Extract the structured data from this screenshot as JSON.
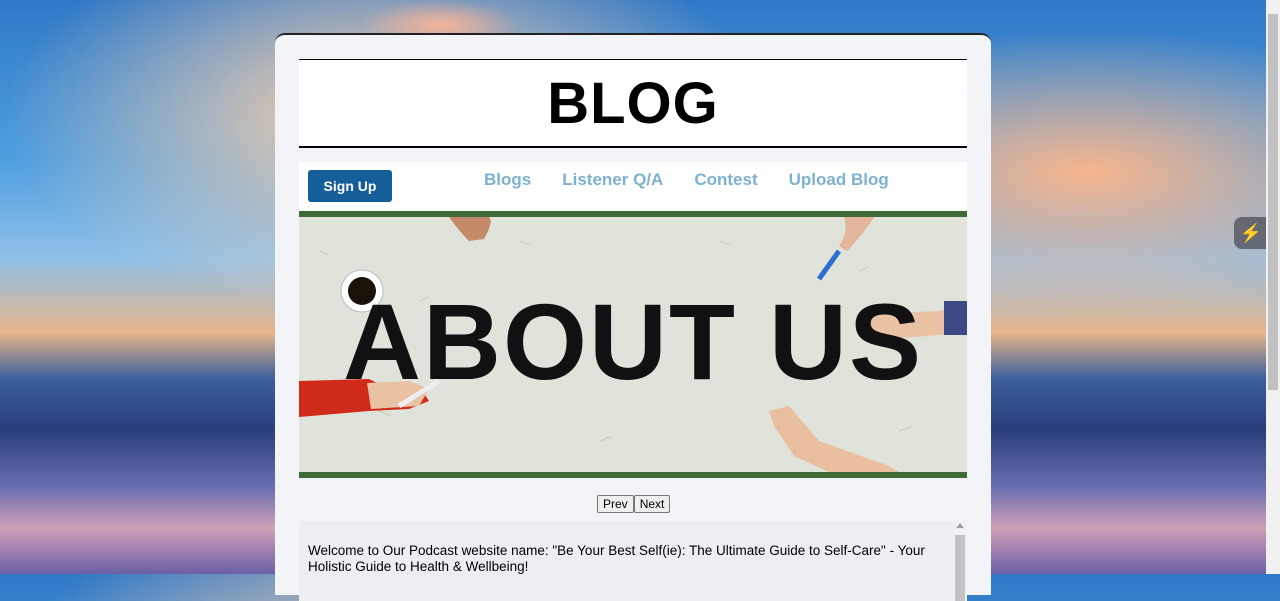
{
  "header": {
    "title": "BLOG"
  },
  "nav": {
    "signup_label": "Sign Up",
    "links": [
      "Blogs",
      "Listener Q/A",
      "Contest",
      "Upload Blog"
    ]
  },
  "hero": {
    "image_text": "ABOUT US"
  },
  "pager": {
    "prev_label": "Prev",
    "next_label": "Next"
  },
  "content": {
    "text": "Welcome to Our Podcast website name: \"Be Your Best Self(ie): The Ultimate Guide to Self-Care\" - Your Holistic Guide to Health & Wellbeing!"
  },
  "colors": {
    "accent": "#155e97",
    "nav_link": "#7db2cf",
    "card_bg": "#f3f4f7"
  },
  "icons": {
    "extension_widget": "bolt-icon"
  }
}
